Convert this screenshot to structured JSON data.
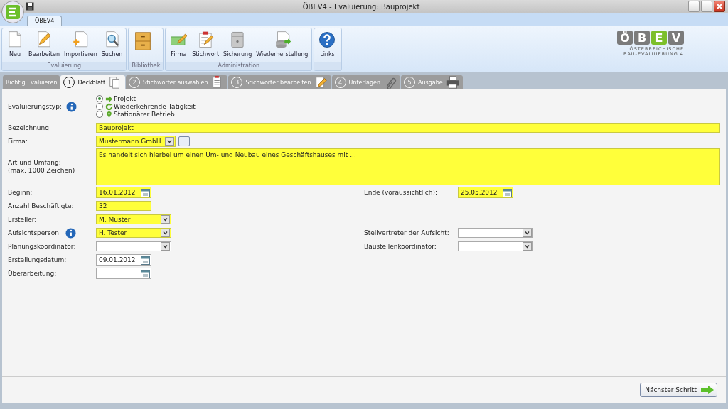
{
  "window": {
    "title": "ÖBEV4 - Evaluierung: Bauprojekt"
  },
  "ribbon_tab": {
    "label": "ÖBEV4",
    "selected": true
  },
  "ribbon_groups": [
    {
      "label": "Evaluierung",
      "buttons": [
        {
          "label": "Neu"
        },
        {
          "label": "Bearbeiten"
        },
        {
          "label": "Importieren"
        },
        {
          "label": "Suchen"
        }
      ]
    },
    {
      "label": "Bibliothek",
      "buttons": [
        {
          "kind": "icon-only"
        }
      ]
    },
    {
      "label": "Administration",
      "buttons": [
        {
          "label": "Firma"
        },
        {
          "label": "Stichwort"
        },
        {
          "label": "Sicherung"
        },
        {
          "label": "Wiederherstellung"
        }
      ]
    },
    {
      "buttons": [
        {
          "label": "Links"
        }
      ]
    }
  ],
  "logo": {
    "letters": [
      {
        "text": "Ö",
        "color": "#7b7b7b"
      },
      {
        "text": "B",
        "color": "#7b7b7b"
      },
      {
        "text": "E",
        "color": "#7cbf2a"
      },
      {
        "text": "V",
        "color": "#7b7b7b"
      }
    ],
    "subtitle": [
      "ÖSTERREICHISCHE",
      "BAU-EVALUIERUNG 4"
    ]
  },
  "steps": [
    {
      "label": "Richtig Evaluieren",
      "selected": false
    },
    {
      "number": "1",
      "label": "Deckblatt",
      "selected": true
    },
    {
      "number": "2",
      "label": "Stichwörter auswählen",
      "selected": false
    },
    {
      "number": "3",
      "label": "Stichwörter bearbeiten",
      "selected": false
    },
    {
      "number": "4",
      "label": "Unterlagen",
      "selected": false
    },
    {
      "number": "5",
      "label": "Ausgabe",
      "selected": false
    }
  ],
  "evaluation_type": {
    "label": "Evaluierungstyp:",
    "info": true,
    "options": [
      {
        "label": "Projekt",
        "selected": true
      },
      {
        "label": "Wiederkehrende Tätigkeit",
        "selected": false
      },
      {
        "label": "Stationärer Betrieb",
        "selected": false
      }
    ]
  },
  "rows": [
    [
      {
        "label": "Bezeichnung:",
        "kind": "text-wide",
        "value": "Bauprojekt",
        "required": true,
        "info": false
      }
    ],
    [
      {
        "label": "Firma:",
        "kind": "select-more",
        "value": "Mustermann GmbH",
        "button": "...",
        "required": true,
        "info": false
      }
    ],
    [
      {
        "label": "Art und Umfang:\n(max. 1000 Zeichen)",
        "kind": "textarea",
        "value": "Es handelt sich hierbei um einen Um- und Neubau eines Geschäftshauses mit ...",
        "required": true,
        "info": false
      }
    ],
    [
      {
        "label": "Beginn:",
        "kind": "date",
        "value": "16.01.2012",
        "required": true,
        "info": false
      },
      {
        "label": "Ende (voraussichtlich):",
        "kind": "date",
        "value": "25.05.2012",
        "required": true,
        "info": false
      }
    ],
    [
      {
        "label": "Anzahl Beschäftigte:",
        "kind": "text-short",
        "value": "32",
        "required": true,
        "info": false
      }
    ],
    [
      {
        "label": "Ersteller:",
        "kind": "select",
        "value": "M. Muster",
        "required": true,
        "info": false
      }
    ],
    [
      {
        "label": "Aufsichtsperson:",
        "kind": "select",
        "value": "H. Tester",
        "required": true,
        "info": true
      },
      {
        "label": "Stellvertreter der Aufsicht:",
        "kind": "select",
        "required": false,
        "info": false
      }
    ],
    [
      {
        "label": "Planungskoordinator:",
        "kind": "select",
        "required": false,
        "info": false
      },
      {
        "label": "Baustellenkoordinator:",
        "kind": "select",
        "required": false,
        "info": false
      }
    ],
    [
      {
        "label": "Erstellungsdatum:",
        "kind": "date",
        "value": "09.01.2012",
        "required": false,
        "info": false
      }
    ],
    [
      {
        "label": "Überarbeitung:",
        "kind": "date",
        "required": false,
        "info": false
      }
    ]
  ],
  "next_button": {
    "label": "Nächster Schritt"
  }
}
